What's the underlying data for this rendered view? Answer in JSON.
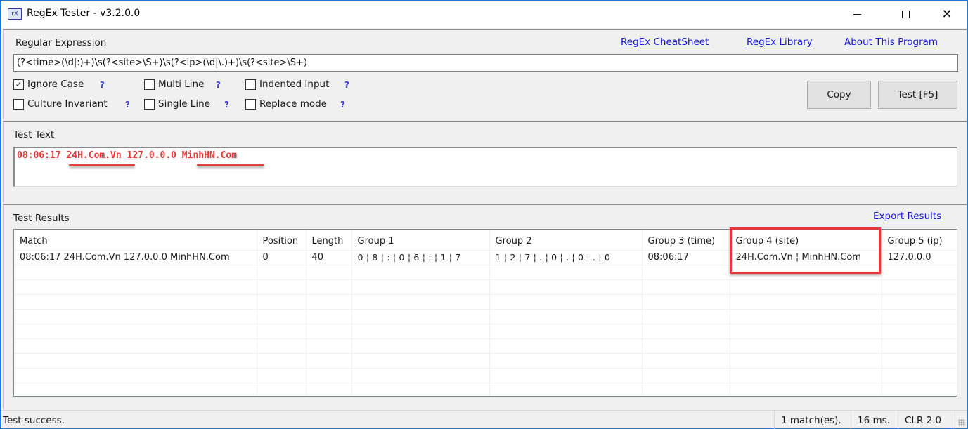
{
  "window": {
    "title": "RegEx Tester - v3.2.0.0",
    "icon_label": "rX",
    "controls": {
      "minimize": "minimize",
      "maximize": "maximize",
      "close": "close"
    }
  },
  "regex_panel": {
    "label": "Regular Expression",
    "links": {
      "cheatsheet": "RegEx CheatSheet",
      "library": "RegEx Library",
      "about": "About This Program"
    },
    "expression": "(?<time>(\\d|:)+)\\s(?<site>\\S+)\\s(?<ip>(\\d|\\.)+)\\s(?<site>\\S+)",
    "options": [
      {
        "label": "Ignore Case",
        "checked": true,
        "help": "?"
      },
      {
        "label": "Multi Line",
        "checked": false,
        "help": "?"
      },
      {
        "label": "Indented Input",
        "checked": false,
        "help": "?"
      },
      {
        "label": "Culture Invariant",
        "checked": false,
        "help": "?"
      },
      {
        "label": "Single Line",
        "checked": false,
        "help": "?"
      },
      {
        "label": "Replace mode",
        "checked": false,
        "help": "?"
      }
    ],
    "buttons": {
      "copy": "Copy",
      "test": "Test [F5]"
    }
  },
  "test_text_panel": {
    "label": "Test Text",
    "value": "08:06:17 24H.Com.Vn 127.0.0.0 MinhHN.Com",
    "annotations": [
      "24H.Com.Vn",
      "MinhHN.Com"
    ],
    "annotation_color": "#e23b3b",
    "text_color": "#ee3333"
  },
  "results_panel": {
    "label": "Test Results",
    "export_link": "Export Results",
    "columns": [
      "Match",
      "Position",
      "Length",
      "Group 1",
      "Group 2",
      "Group 3 (time)",
      "Group 4 (site)",
      "Group 5 (ip)"
    ],
    "rows": [
      [
        "08:06:17 24H.Com.Vn 127.0.0.0 MinhHN.Com",
        "0",
        "40",
        "0 ¦ 8 ¦ : ¦ 0 ¦ 6 ¦ : ¦ 1 ¦ 7",
        "1 ¦ 2 ¦ 7 ¦ . ¦ 0 ¦ . ¦ 0 ¦ . ¦ 0",
        "08:06:17",
        "24H.Com.Vn ¦ MinhHN.Com",
        "127.0.0.0"
      ]
    ],
    "highlighted_column": "Group 4 (site)",
    "highlight_color": "#e5363b"
  },
  "status_bar": {
    "message": "Test success.",
    "matches": "1 match(es).",
    "time": "16 ms.",
    "runtime": "CLR 2.0"
  }
}
